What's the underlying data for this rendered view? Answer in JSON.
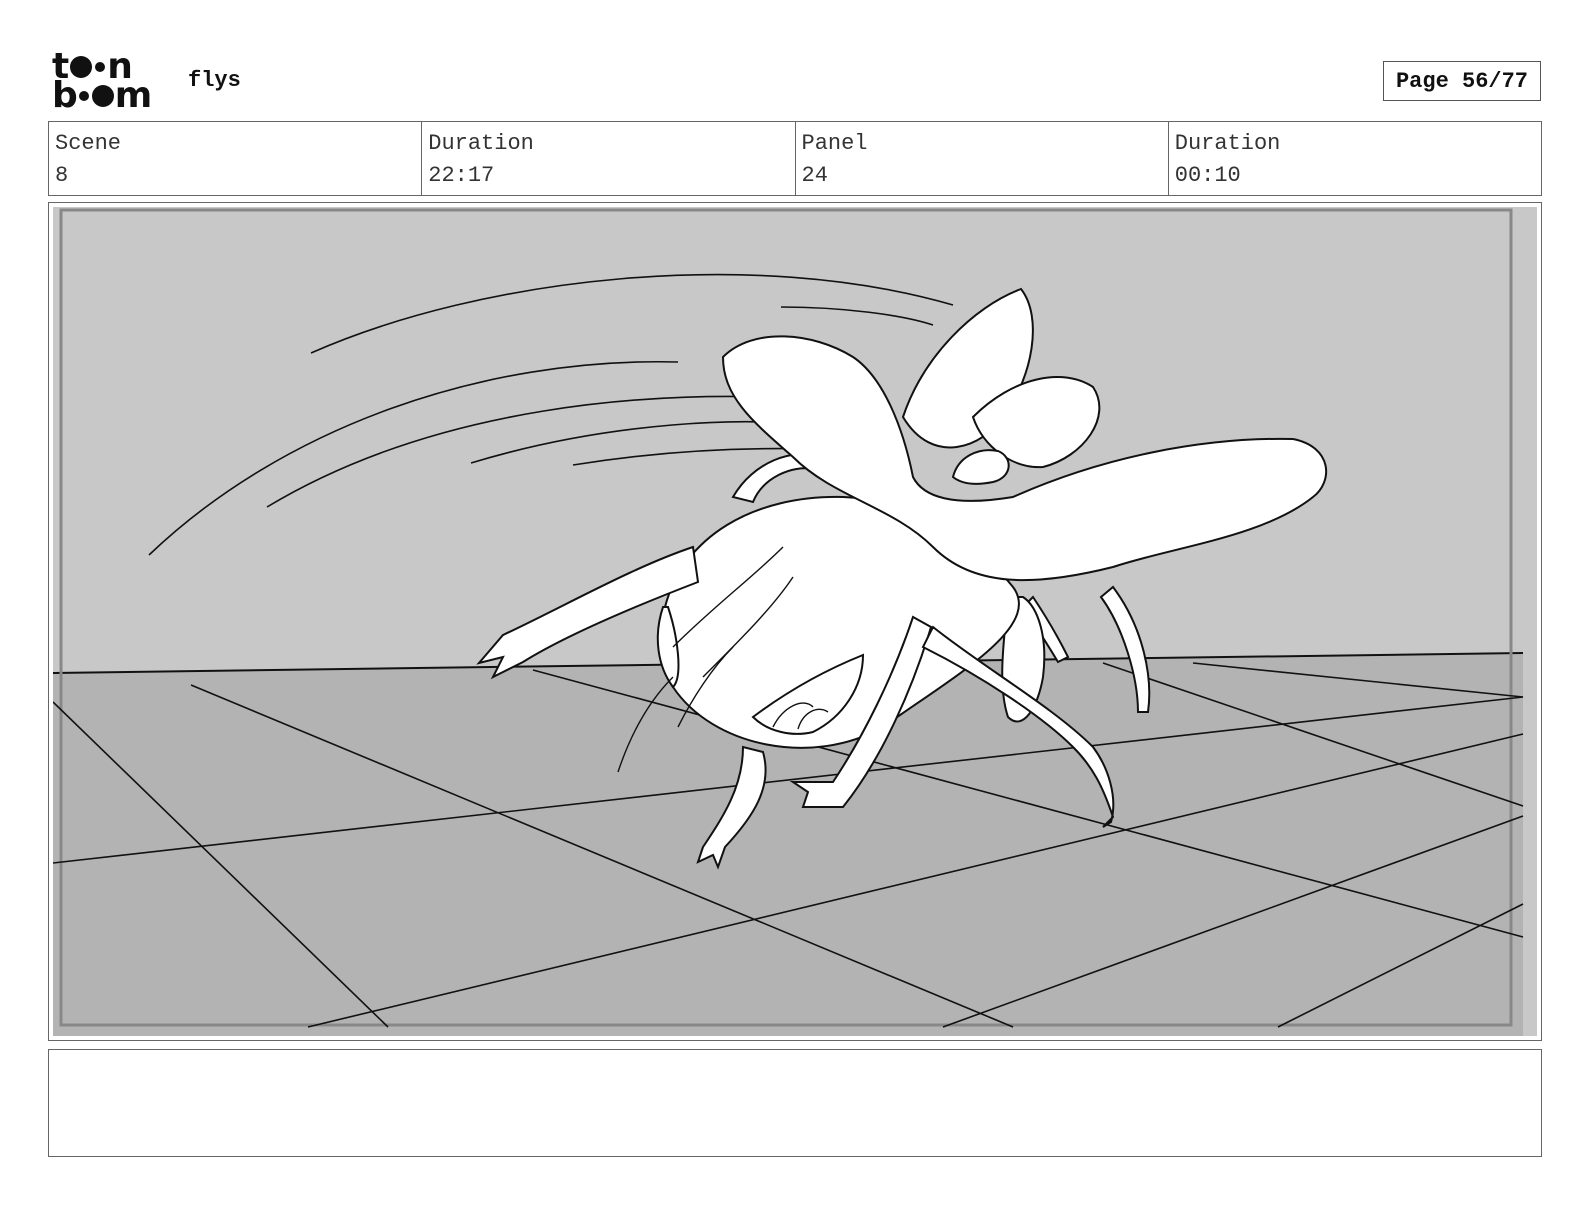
{
  "logo": {
    "line1": "t  n",
    "line2": "b  m"
  },
  "project": {
    "title": "flys"
  },
  "page": {
    "label": "Page 56/77"
  },
  "info": {
    "scene_label": "Scene",
    "scene_value": "8",
    "duration_label": "Duration",
    "duration_value": "22:17",
    "panel_label": "Panel",
    "panel_value": "24",
    "panel_duration_label": "Duration",
    "panel_duration_value": "00:10"
  },
  "notes": {
    "text": ""
  }
}
